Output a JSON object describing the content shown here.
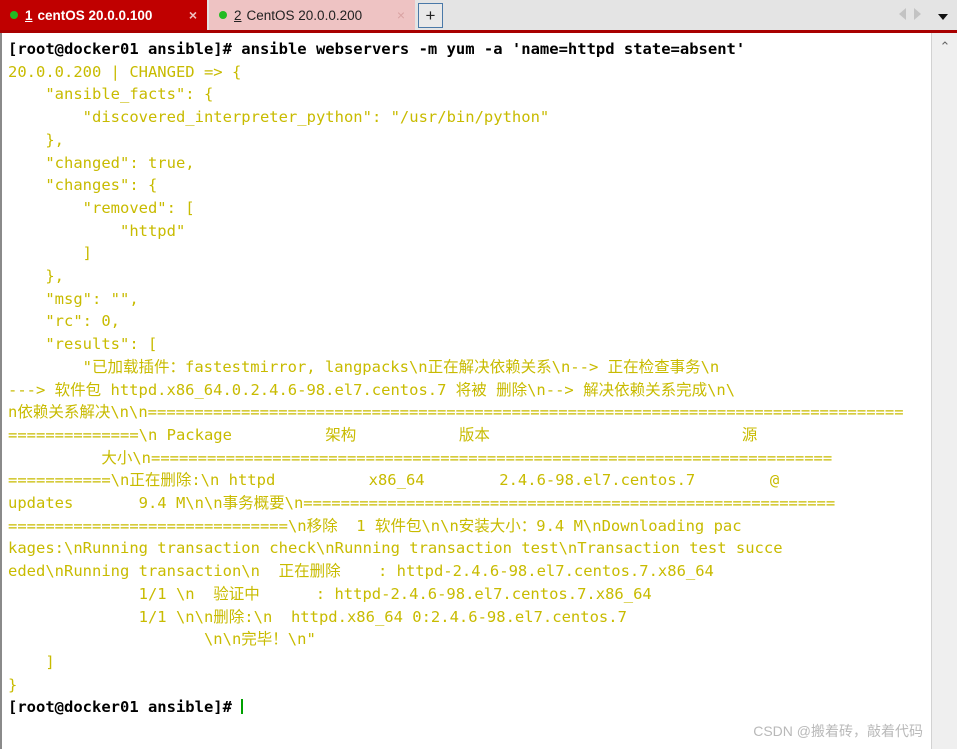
{
  "window": {
    "tabs": [
      {
        "num": "1",
        "title": "centOS 20.0.0.100",
        "close": "×",
        "active": true
      },
      {
        "num": "2",
        "title": "CentOS 20.0.0.200",
        "close": "×",
        "active": false
      }
    ],
    "new_tab_label": "+",
    "nav_prev_label": "◀",
    "nav_next_label": "▶",
    "tab_menu_label": "▼",
    "status_dot_color": "#22bb22",
    "active_tab_color": "#c00000",
    "inactive_tab_color": "#eec3c3"
  },
  "scrollbar": {
    "up_arrow": "⌃"
  },
  "terminal": {
    "fg_color": "#c8bb00",
    "prompt_color": "#000000",
    "cursor_color": "#00a000",
    "lines": [
      {
        "type": "prompt",
        "text": "[root@docker01 ansible]# ansible webservers -m yum -a 'name=httpd state=absent'"
      },
      {
        "type": "out",
        "text": "20.0.0.200 | CHANGED => {"
      },
      {
        "type": "out",
        "text": "    \"ansible_facts\": {"
      },
      {
        "type": "out",
        "text": "        \"discovered_interpreter_python\": \"/usr/bin/python\""
      },
      {
        "type": "out",
        "text": "    },"
      },
      {
        "type": "out",
        "text": "    \"changed\": true,"
      },
      {
        "type": "out",
        "text": "    \"changes\": {"
      },
      {
        "type": "out",
        "text": "        \"removed\": ["
      },
      {
        "type": "out",
        "text": "            \"httpd\""
      },
      {
        "type": "out",
        "text": "        ]"
      },
      {
        "type": "out",
        "text": "    },"
      },
      {
        "type": "out",
        "text": "    \"msg\": \"\","
      },
      {
        "type": "out",
        "text": "    \"rc\": 0,"
      },
      {
        "type": "out",
        "text": "    \"results\": ["
      },
      {
        "type": "out",
        "text": "        \"已加载插件：fastestmirror, langpacks\\n正在解决依赖关系\\n--> 正在检查事务\\n"
      },
      {
        "type": "out",
        "text": "---> 软件包 httpd.x86_64.0.2.4.6-98.el7.centos.7 将被 删除\\n--> 解决依赖关系完成\\n\\"
      },
      {
        "type": "out",
        "text": "n依赖关系解决\\n\\n================================================================================="
      },
      {
        "type": "out",
        "text": "==============\\n Package          架构           版本                           源"
      },
      {
        "type": "out",
        "text": "          大小\\n========================================================================="
      },
      {
        "type": "out",
        "text": "===========\\n正在删除:\\n httpd          x86_64        2.4.6-98.el7.centos.7        @"
      },
      {
        "type": "out",
        "text": "updates       9.4 M\\n\\n事务概要\\n========================================================="
      },
      {
        "type": "out",
        "text": "==============================\\n移除  1 软件包\\n\\n安装大小：9.4 M\\nDownloading pac"
      },
      {
        "type": "out",
        "text": "kages:\\nRunning transaction check\\nRunning transaction test\\nTransaction test succe"
      },
      {
        "type": "out",
        "text": "eded\\nRunning transaction\\n  正在删除    : httpd-2.4.6-98.el7.centos.7.x86_64"
      },
      {
        "type": "out",
        "text": "              1/1 \\n  验证中      : httpd-2.4.6-98.el7.centos.7.x86_64"
      },
      {
        "type": "out",
        "text": "              1/1 \\n\\n删除:\\n  httpd.x86_64 0:2.4.6-98.el7.centos.7"
      },
      {
        "type": "out",
        "text": "                     \\n\\n完毕！\\n\""
      },
      {
        "type": "out",
        "text": "    ]"
      },
      {
        "type": "out",
        "text": "}"
      },
      {
        "type": "prompt_cursor",
        "text": "[root@docker01 ansible]# "
      }
    ]
  },
  "watermark": {
    "text": "CSDN @搬着砖，敲着代码"
  }
}
